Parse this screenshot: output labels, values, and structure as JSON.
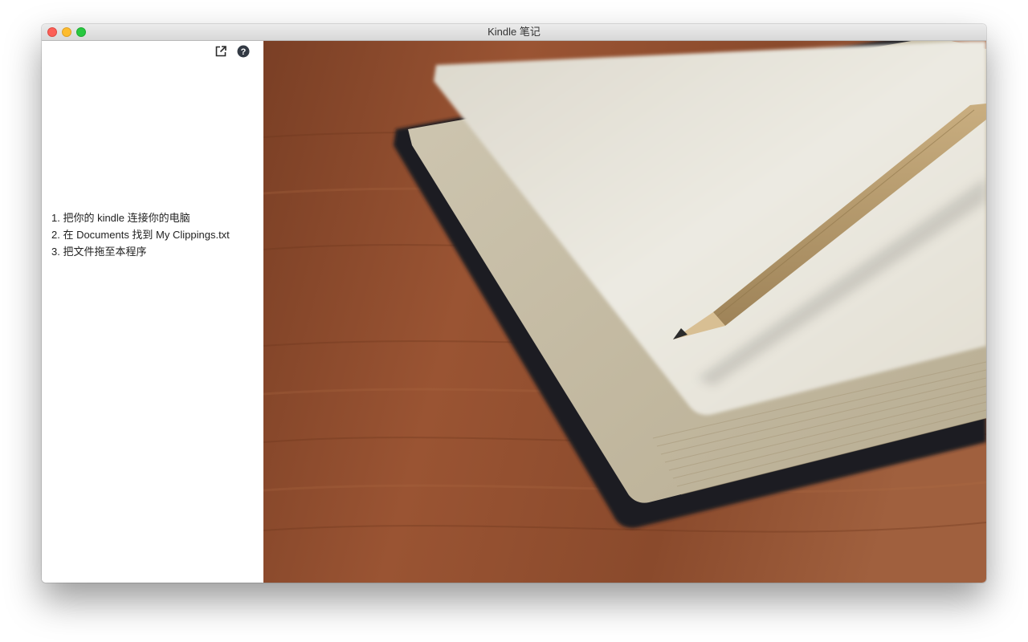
{
  "window": {
    "title": "Kindle 笔记"
  },
  "toolbar": {
    "export_icon": "external-link-icon",
    "help_icon": "question-circle-icon"
  },
  "instructions": {
    "steps": [
      "1. 把你的 kindle 连接你的电脑",
      "2. 在 Documents 找到 My Clippings.txt",
      "3. 把文件拖至本程序"
    ]
  },
  "colors": {
    "wood": "#8a4a2c",
    "paper": "#e6e1d4",
    "cover": "#1e2024",
    "pencil": "#b79b6f"
  }
}
